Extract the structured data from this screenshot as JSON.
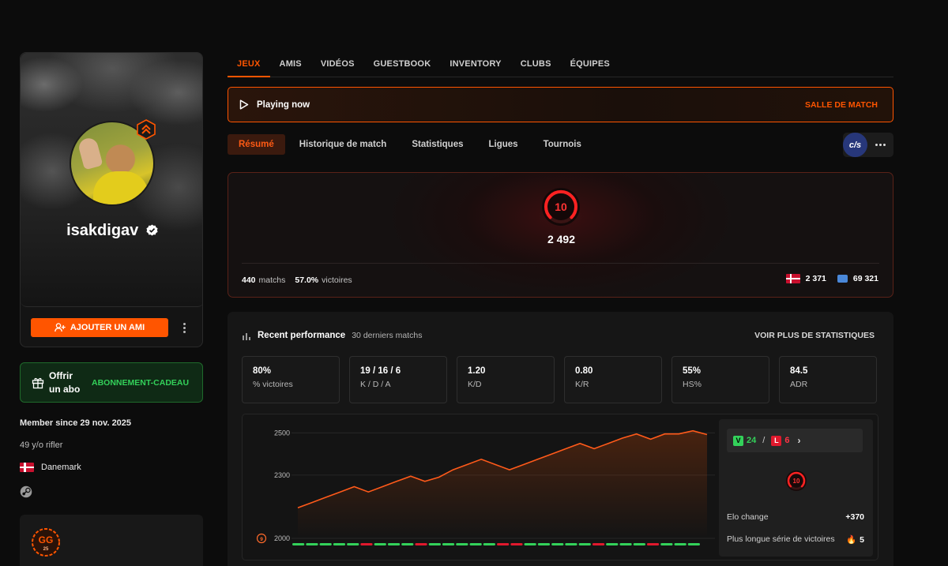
{
  "profile": {
    "username": "isakdigav",
    "add_friend_label": "AJOUTER UN AMI",
    "member_since": "Member since 29 nov. 2025",
    "age_line": "49 y/o rifler",
    "country": "Danemark"
  },
  "gift": {
    "line": "Offrir un abo",
    "cta": "ABONNEMENT-CADEAU"
  },
  "top_tabs": [
    "JEUX",
    "AMIS",
    "VIDÉOS",
    "GUESTBOOK",
    "INVENTORY",
    "CLUBS",
    "ÉQUIPES"
  ],
  "playing_banner": {
    "label": "Playing now",
    "cta": "SALLE DE MATCH"
  },
  "sub_tabs": [
    "Résumé",
    "Historique de match",
    "Statistiques",
    "Ligues",
    "Tournois"
  ],
  "game_logo_text": "c/s",
  "elo_card": {
    "level": "10",
    "elo": "2 492",
    "matches_value": "440",
    "matches_label": "matchs",
    "winrate_value": "57.0%",
    "winrate_label": "victoires",
    "country_rank": "2 371",
    "region_rank": "69 321"
  },
  "recent": {
    "title": "Recent performance",
    "subtitle": "30 derniers matchs",
    "more_link": "VOIR PLUS DE STATISTIQUES",
    "tiles": [
      {
        "value": "80%",
        "label": "% victoires"
      },
      {
        "value": "19 / 16 / 6",
        "label": "K / D / A"
      },
      {
        "value": "1.20",
        "label": "K/D"
      },
      {
        "value": "0.80",
        "label": "K/R"
      },
      {
        "value": "55%",
        "label": "HS%"
      },
      {
        "value": "84.5",
        "label": "ADR"
      }
    ],
    "wins": "24",
    "wins_letter": "V",
    "losses": "6",
    "losses_letter": "L",
    "panel_level": "10",
    "elo_change_label": "Elo change",
    "elo_change_value": "+370",
    "streak_label": "Plus longue série de victoires",
    "streak_value": "5",
    "chart_level_marker": "9"
  },
  "colors": {
    "accent": "#ff5500",
    "win": "#33d15a",
    "loss": "#e0192d"
  },
  "chart_data": {
    "type": "area",
    "ylim": [
      2000,
      2500
    ],
    "yticks": [
      2000,
      2300,
      2500
    ],
    "x": [
      1,
      2,
      3,
      4,
      5,
      6,
      7,
      8,
      9,
      10,
      11,
      12,
      13,
      14,
      15,
      16,
      17,
      18,
      19,
      20,
      21,
      22,
      23,
      24,
      25,
      26,
      27,
      28,
      29,
      30
    ],
    "values": [
      2145,
      2170,
      2195,
      2220,
      2245,
      2220,
      2245,
      2270,
      2295,
      2270,
      2290,
      2325,
      2350,
      2375,
      2350,
      2325,
      2350,
      2375,
      2400,
      2425,
      2450,
      2425,
      2450,
      2475,
      2495,
      2470,
      2495,
      2495,
      2510,
      2492
    ],
    "results": [
      "W",
      "W",
      "W",
      "W",
      "W",
      "L",
      "W",
      "W",
      "W",
      "L",
      "W",
      "W",
      "W",
      "W",
      "W",
      "L",
      "L",
      "W",
      "W",
      "W",
      "W",
      "W",
      "L",
      "W",
      "W",
      "W",
      "L",
      "W",
      "W",
      "W"
    ]
  }
}
